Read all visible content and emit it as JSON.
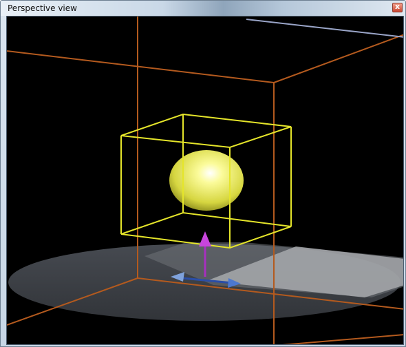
{
  "window": {
    "title": "Perspective view",
    "close_label": "x"
  },
  "colors": {
    "background": "#000000",
    "room_box": "#b45a1e",
    "selection_box": "#e5e52a",
    "sphere": "#eeee55",
    "ground": "#3d4045",
    "gizmo_y": "#a72fbf",
    "gizmo_x": "#2b4ea6"
  },
  "scene": {
    "objects": [
      "room-bounding-box",
      "selected-object-bounds",
      "sphere",
      "ground-disc",
      "translate-gizmo"
    ]
  }
}
